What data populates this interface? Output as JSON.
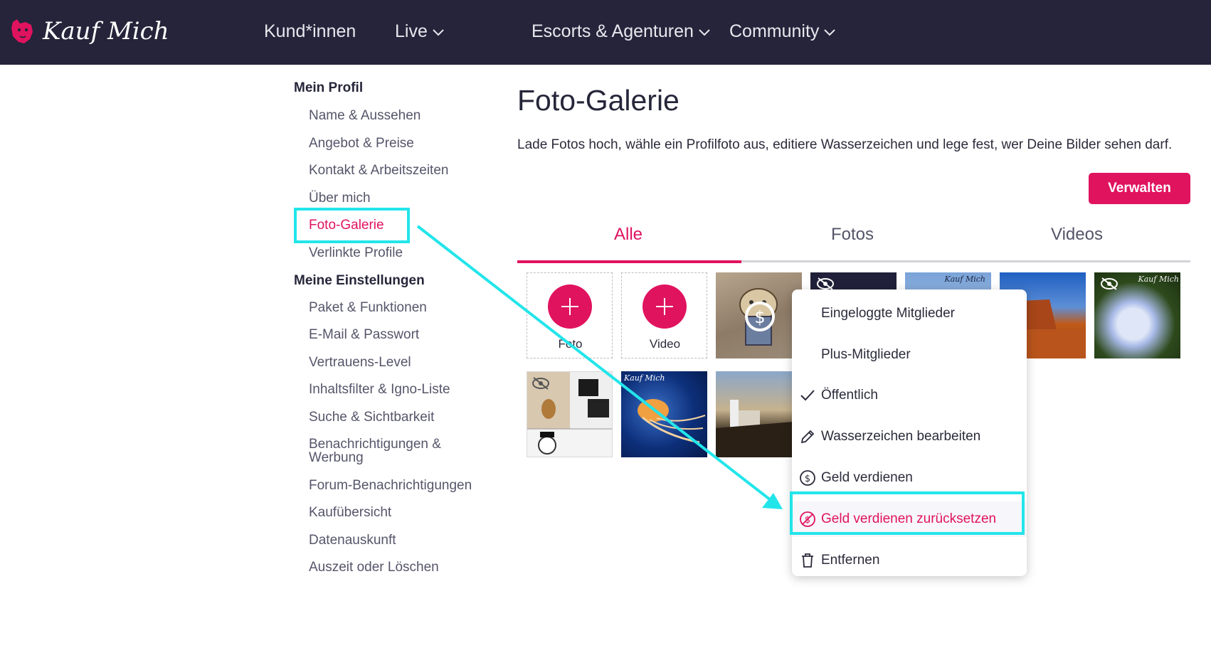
{
  "header": {
    "brand": "Kauf Mich",
    "nav": [
      {
        "label": "Kund*innen",
        "has_dropdown": false
      },
      {
        "label": "Live",
        "has_dropdown": true
      },
      {
        "label": "Escorts & Agenturen",
        "has_dropdown": true
      },
      {
        "label": "Community",
        "has_dropdown": true
      }
    ]
  },
  "sidebar": {
    "section1": "Mein Profil",
    "profile_items": [
      "Name & Aussehen",
      "Angebot & Preise",
      "Kontakt & Arbeitszeiten",
      "Über mich",
      "Foto-Galerie",
      "Verlinkte Profile"
    ],
    "section2": "Meine Einstellungen",
    "settings_items": [
      "Paket & Funktionen",
      "E-Mail & Passwort",
      "Vertrauens-Level",
      "Inhaltsfilter & Igno-Liste",
      "Suche & Sichtbarkeit",
      "Benachrichtigungen & Werbung",
      "Forum-Benachrichtigungen",
      "Kaufübersicht",
      "Datenauskunft",
      "Auszeit oder Löschen"
    ],
    "active_item": "Foto-Galerie"
  },
  "main": {
    "title": "Foto-Galerie",
    "description": "Lade Fotos hoch, wähle ein Profilfoto aus, editiere Wasserzeichen und lege fest, wer Deine Bilder sehen darf.",
    "manage_button": "Verwalten",
    "tabs": [
      "Alle",
      "Fotos",
      "Videos"
    ],
    "active_tab": "Alle",
    "add_photo_label": "Foto",
    "add_video_label": "Video",
    "watermark_text": "Kauf Mich"
  },
  "context_menu": {
    "items": [
      {
        "label": "Eingeloggte Mitglieder",
        "icon": "none"
      },
      {
        "label": "Plus-Mitglieder",
        "icon": "none"
      },
      {
        "label": "Öffentlich",
        "icon": "check-icon"
      },
      {
        "label": "Wasserzeichen bearbeiten",
        "icon": "pencil-icon"
      },
      {
        "label": "Geld verdienen",
        "icon": "dollar-circle-icon"
      },
      {
        "label": "Geld verdienen zurücksetzen",
        "icon": "dollar-off-icon"
      },
      {
        "label": "Entfernen",
        "icon": "trash-icon"
      }
    ]
  },
  "colors": {
    "accent": "#e0135f",
    "header_bg": "#25243a",
    "annotation": "#22e5ea"
  }
}
